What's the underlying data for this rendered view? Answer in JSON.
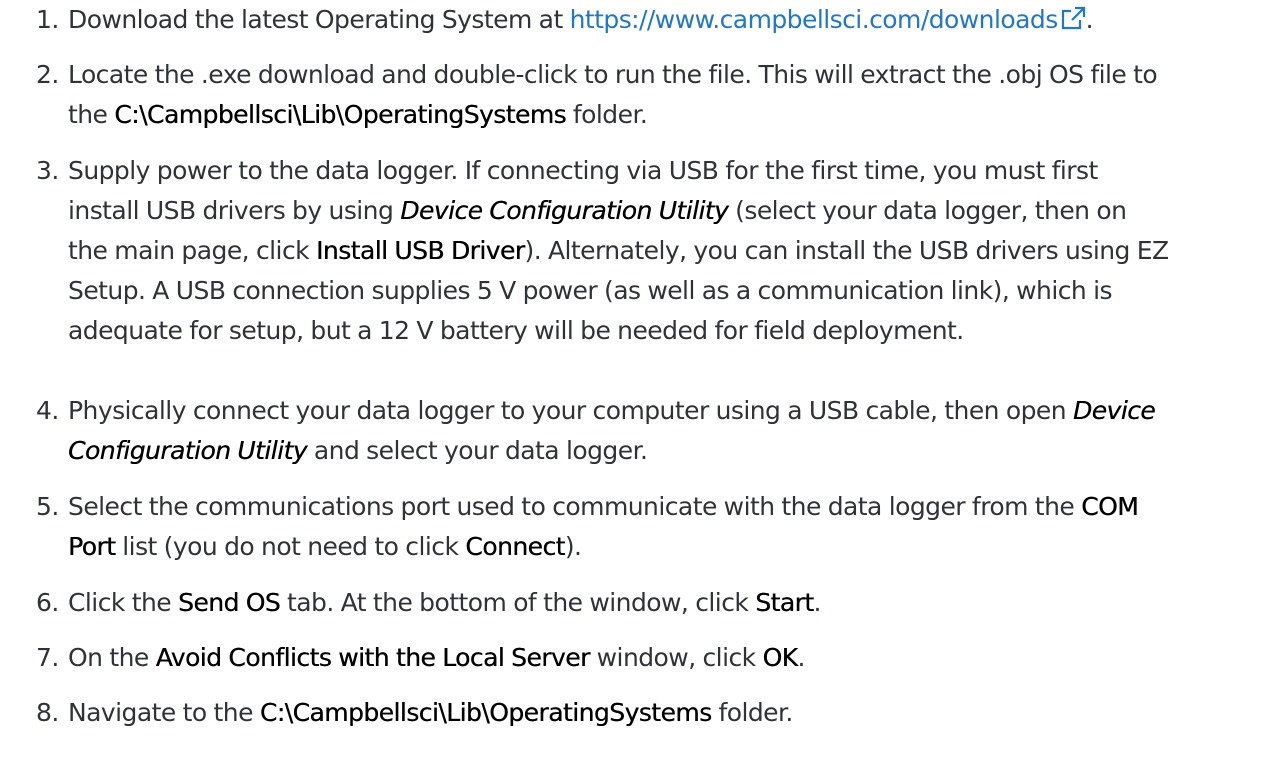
{
  "colors": {
    "text": "#2f3338",
    "emphasis": "#000000",
    "link": "#1f78c8"
  },
  "icons": {
    "external_link": "external-link-icon"
  },
  "steps": [
    {
      "num": "1.",
      "lines": [
        {
          "a": "Download the latest Operating System at ",
          "link": "https://www.campbellsci.com/downloads",
          "b": "."
        }
      ]
    },
    {
      "num": "2.",
      "lines": [
        {
          "a": "Locate the .exe download and double-click to run the file. This will extract the .obj OS file to"
        },
        {
          "a": "the ",
          "ui": "C:\\Campbellsci\\Lib\\OperatingSystems",
          "b": " folder."
        }
      ]
    },
    {
      "num": "3.",
      "lines": [
        {
          "a": "Supply power to the data logger. If connecting via USB for the first time, you must first"
        },
        {
          "a": "install USB drivers by using ",
          "em": "Device Configuration Utility",
          "b": " (select your data logger, then on"
        },
        {
          "a": "the main page, click ",
          "ui": "Install USB Driver",
          "b": "). Alternately, you can install the USB drivers using EZ"
        },
        {
          "a": "Setup. A USB connection supplies 5 V power (as well as a communication link), which is"
        },
        {
          "a": "adequate for setup, but a 12 V battery will be needed for field deployment."
        }
      ]
    },
    {
      "num": "4.",
      "lines": [
        {
          "a": "Physically connect your data logger to your computer using a USB cable, then open ",
          "em": "Device"
        },
        {
          "em": "Configuration Utility",
          "b": " and select your data logger."
        }
      ]
    },
    {
      "num": "5.",
      "lines": [
        {
          "a": "Select the communications port used to communicate with the data logger from the ",
          "ui": "COM"
        },
        {
          "ui": "Port",
          "b": " list (you do not need to click ",
          "ui2": "Connect",
          "c": ")."
        }
      ]
    },
    {
      "num": "6.",
      "lines": [
        {
          "a": "Click the ",
          "ui": "Send OS",
          "b": " tab. At the bottom of the window, click ",
          "ui2": "Start",
          "c": "."
        }
      ]
    },
    {
      "num": "7.",
      "lines": [
        {
          "a": "On the ",
          "ui": "Avoid Conflicts with the Local Server",
          "b": " window, click ",
          "ui2": "OK",
          "c": "."
        }
      ]
    },
    {
      "num": "8.",
      "lines": [
        {
          "a": "Navigate to the ",
          "ui": "C:\\Campbellsci\\Lib\\OperatingSystems",
          "b": " folder."
        }
      ]
    }
  ]
}
